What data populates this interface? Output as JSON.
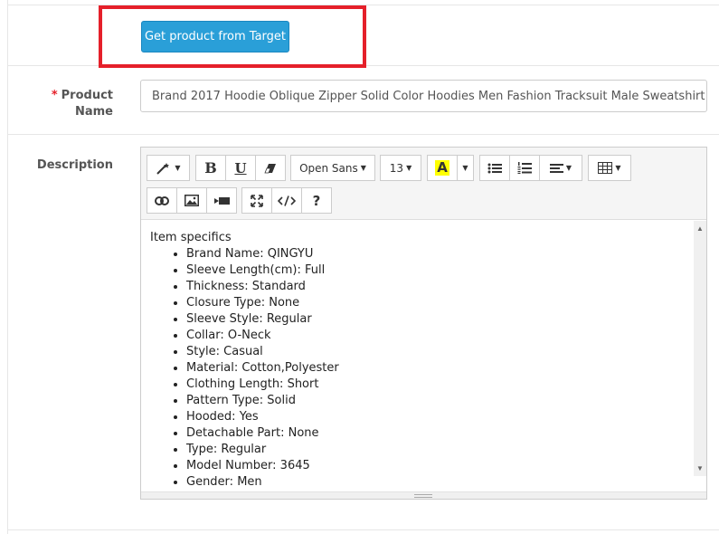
{
  "get_product_button": "Get product from Target",
  "product_name": {
    "required_mark": "*",
    "label_line1": "Product",
    "label_line2": "Name",
    "value": "Brand 2017 Hoodie Oblique Zipper Solid Color Hoodies Men Fashion Tracksuit Male Sweatshirt Hoo"
  },
  "description": {
    "label": "Description",
    "toolbar": {
      "font_family": "Open Sans",
      "font_size": "13",
      "bold": "B",
      "underline": "U",
      "color_letter": "A",
      "help": "?",
      "highlight_color": "#ffff00"
    },
    "content_title": "Item specifics",
    "items": [
      "Brand Name: QINGYU",
      "Sleeve Length(cm): Full",
      "Thickness: Standard",
      "Closure Type: None",
      "Sleeve Style: Regular",
      "Collar: O-Neck",
      "Style: Casual",
      "Material: Cotton,Polyester",
      "Clothing Length: Short",
      "Pattern Type: Solid",
      "Hooded: Yes",
      "Detachable Part: None",
      "Type: Regular",
      "Model Number: 3645",
      "Gender: Men"
    ]
  },
  "colors": {
    "primary_button": "#2a9fd8",
    "highlight_border": "#e5202a",
    "required": "#e5202a"
  }
}
